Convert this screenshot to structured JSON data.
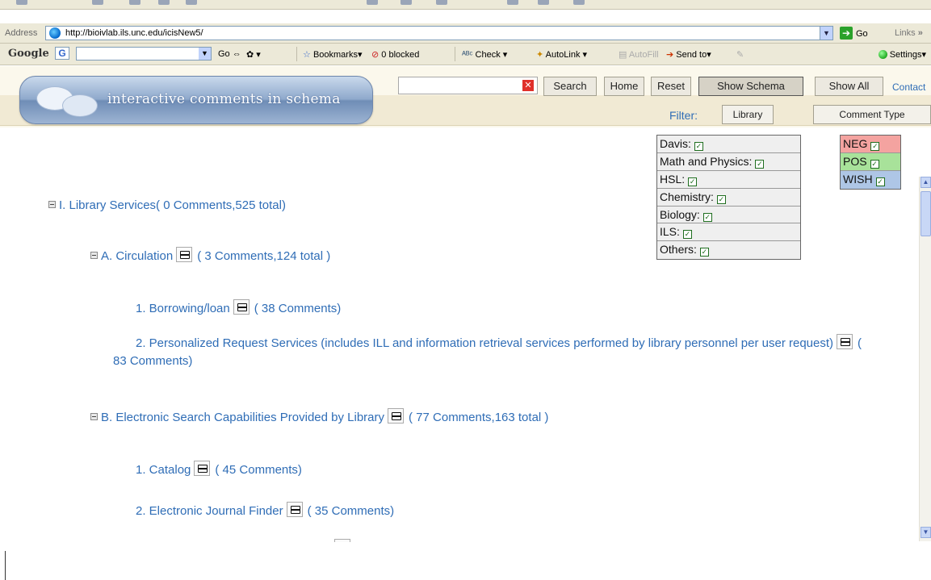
{
  "browser": {
    "address_label": "Address",
    "url": "http://bioivlab.ils.unc.edu/icisNew5/",
    "go_label": "Go",
    "links_label": "Links",
    "overflow_glyph": "»"
  },
  "google_toolbar": {
    "logo": "Google",
    "g_button": "G",
    "go_label": "Go",
    "bookmarks": "Bookmarks",
    "blocked": "0 blocked",
    "check": "Check",
    "autolink": "AutoLink",
    "autofill": "AutoFill",
    "sendto": "Send to",
    "settings": "Settings"
  },
  "app": {
    "title": "interactive comments in schema",
    "search_placeholder": "",
    "clear_glyph": "✕",
    "buttons": {
      "search": "Search",
      "home": "Home",
      "reset": "Reset",
      "show_schema": "Show Schema",
      "show_all": "Show All"
    },
    "contact": "Contact"
  },
  "filter": {
    "label": "Filter:",
    "library_button": "Library",
    "comment_type_button": "Comment Type",
    "libraries": [
      {
        "label": "Davis:",
        "checked": true
      },
      {
        "label": "Math and Physics:",
        "checked": true
      },
      {
        "label": "HSL:",
        "checked": true
      },
      {
        "label": "Chemistry:",
        "checked": true
      },
      {
        "label": "Biology:",
        "checked": true
      },
      {
        "label": "ILS:",
        "checked": true
      },
      {
        "label": "Others:",
        "checked": true
      }
    ],
    "types": [
      {
        "label": "NEG",
        "checked": true,
        "color": "#f4a3a0"
      },
      {
        "label": "POS",
        "checked": true,
        "color": "#a8e29a"
      },
      {
        "label": "WISH",
        "checked": true,
        "color": "#aec6e6"
      }
    ]
  },
  "schema": {
    "root": {
      "title": "I. Library Services",
      "counts": "( 0 Comments,525 total)"
    },
    "a": {
      "title": "A. Circulation",
      "counts": "( 3 Comments,124 total )"
    },
    "a1": {
      "title": "1. Borrowing/loan",
      "counts": "( 38 Comments)"
    },
    "a2": {
      "title": "2. Personalized Request Services (includes ILL and information retrieval services performed by library personnel per user request)",
      "counts": "( 83 Comments)"
    },
    "b": {
      "title": "B. Electronic Search Capabilities Provided by Library",
      "counts": "( 77 Comments,163 total )"
    },
    "b1": {
      "title": "1. Catalog",
      "counts": "( 45 Comments)"
    },
    "b2": {
      "title": "2. Electronic Journal Finder",
      "counts": "( 35 Comments)"
    }
  },
  "colors": {
    "link": "#2f6db6",
    "header_bg": "#f1ead4"
  }
}
